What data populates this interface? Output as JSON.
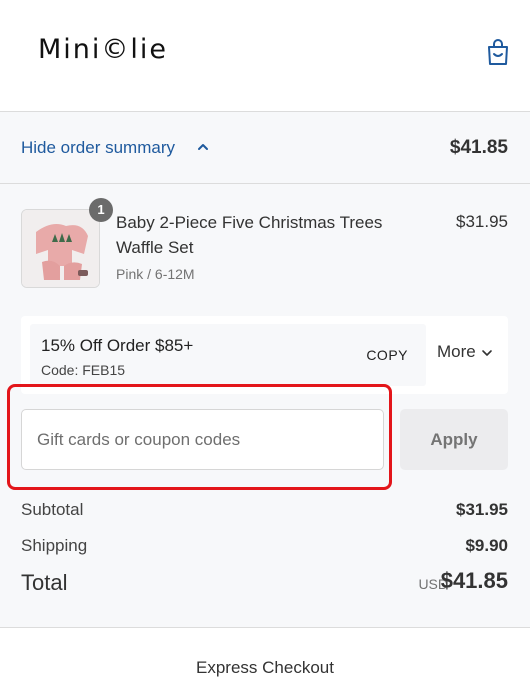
{
  "header": {
    "logo_text": "Mini©lie",
    "cart_icon": "shopping-bag-icon"
  },
  "summary_toggle": {
    "label": "Hide order summary",
    "total": "$41.85"
  },
  "product": {
    "quantity": "1",
    "name": "Baby 2-Piece Five Christmas Trees Waffle Set",
    "variant": "Pink / 6-12M",
    "price": "$31.95"
  },
  "promo": {
    "title": "15% Off Order $85+",
    "code": "Code: FEB15",
    "copy_label": "COPY",
    "more_label": "More"
  },
  "coupon": {
    "placeholder": "Gift cards or coupon codes",
    "value": "",
    "apply_label": "Apply"
  },
  "totals": {
    "subtotal_label": "Subtotal",
    "subtotal_value": "$31.95",
    "shipping_label": "Shipping",
    "shipping_value": "$9.90",
    "total_label": "Total",
    "currency": "USD",
    "total_value": "$41.85"
  },
  "express": {
    "label": "Express Checkout"
  },
  "colors": {
    "link_blue": "#1f5a9e",
    "highlight_red": "#e3151a",
    "panel_bg": "#f7f8fa"
  }
}
